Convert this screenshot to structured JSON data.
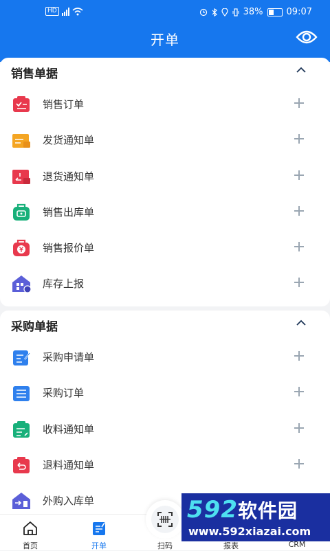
{
  "status_bar": {
    "time": "09:07",
    "battery": "38%",
    "network": "HD"
  },
  "nav": {
    "title": "开单"
  },
  "sections": [
    {
      "title": "销售单据",
      "items": [
        {
          "label": "销售订单",
          "icon": "sales-order-icon",
          "color": "#e8394d"
        },
        {
          "label": "发货通知单",
          "icon": "delivery-notice-icon",
          "color": "#f4a523"
        },
        {
          "label": "退货通知单",
          "icon": "return-notice-icon",
          "color": "#e8394d"
        },
        {
          "label": "销售出库单",
          "icon": "sales-outbound-icon",
          "color": "#18b07a"
        },
        {
          "label": "销售报价单",
          "icon": "quotation-icon",
          "color": "#e8394d"
        },
        {
          "label": "库存上报",
          "icon": "inventory-report-icon",
          "color": "#5b5fd8"
        }
      ]
    },
    {
      "title": "采购单据",
      "items": [
        {
          "label": "采购申请单",
          "icon": "purchase-request-icon",
          "color": "#2f80ed"
        },
        {
          "label": "采购订单",
          "icon": "purchase-order-icon",
          "color": "#2f80ed"
        },
        {
          "label": "收料通知单",
          "icon": "receiving-notice-icon",
          "color": "#18b07a"
        },
        {
          "label": "退料通知单",
          "icon": "material-return-icon",
          "color": "#e8394d"
        },
        {
          "label": "外购入库单",
          "icon": "purchase-inbound-icon",
          "color": "#5b5fd8"
        }
      ]
    }
  ],
  "tabs": [
    {
      "label": "首页",
      "icon": "home-icon"
    },
    {
      "label": "开单",
      "icon": "order-icon",
      "active": true
    },
    {
      "label": "扫码",
      "icon": "scan-icon"
    },
    {
      "label": "报表",
      "icon": "report-icon"
    },
    {
      "label": "CRM",
      "icon": "crm-icon"
    }
  ],
  "watermark": {
    "logo_digits": "592",
    "logo_text": "软件园",
    "url": "www.592xiazai.com"
  },
  "colors": {
    "primary": "#1677ee",
    "plus": "#9aa6b2"
  }
}
